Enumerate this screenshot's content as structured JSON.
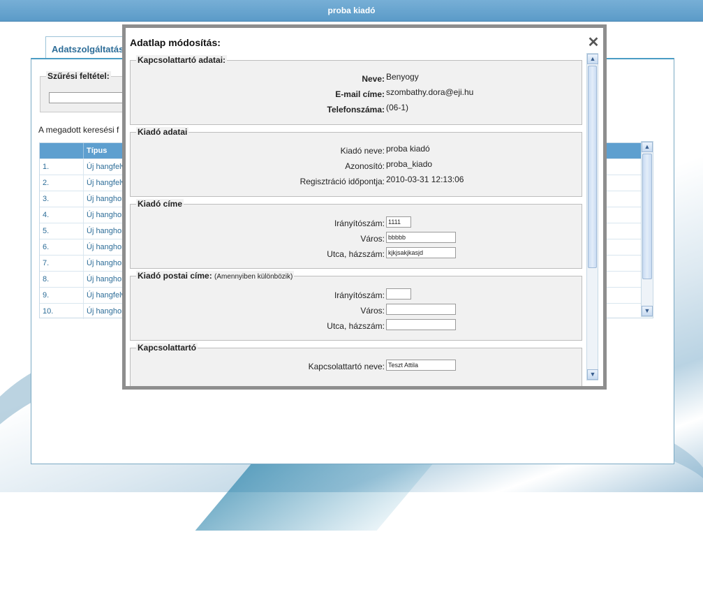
{
  "header": {
    "title": "proba kiadó"
  },
  "background": {
    "tab_label": "Adatszolgáltatás",
    "filter_label": "Szűrési feltétel:",
    "result_text": "A megadott keresési f",
    "grid": {
      "col_type": "Típus",
      "rows": [
        {
          "num": "1.",
          "type": "Új hangfelv"
        },
        {
          "num": "2.",
          "type": "Új hangfelv"
        },
        {
          "num": "3.",
          "type": "Új hanghor"
        },
        {
          "num": "4.",
          "type": "Új hanghor"
        },
        {
          "num": "5.",
          "type": "Új hanghor"
        },
        {
          "num": "6.",
          "type": "Új hanghor"
        },
        {
          "num": "7.",
          "type": "Új hanghor"
        },
        {
          "num": "8.",
          "type": "Új hanghor"
        },
        {
          "num": "9.",
          "type": "Új hangfelv"
        },
        {
          "num": "10.",
          "type": "Új hanghor"
        }
      ]
    }
  },
  "modal": {
    "title": "Adatlap módosítás:",
    "close_symbol": "✕",
    "sections": {
      "contact": {
        "legend": "Kapcsolattartó adatai:",
        "name_label": "Neve:",
        "name_value": "Benyogy",
        "email_label": "E-mail címe:",
        "email_value": "szombathy.dora@eji.hu",
        "phone_label": "Telefonszáma:",
        "phone_value": "(06-1)"
      },
      "publisher": {
        "legend": "Kiadó adatai",
        "name_label": "Kiadó neve:",
        "name_value": "proba kiadó",
        "id_label": "Azonosító:",
        "id_value": "proba_kiado",
        "reg_label": "Regisztráció időpontja:",
        "reg_value": "2010-03-31 12:13:06"
      },
      "address": {
        "legend": "Kiadó címe",
        "zip_label": "Irányítószám:",
        "zip_value": "1111",
        "city_label": "Város:",
        "city_value": "bbbbb",
        "street_label": "Utca, házszám:",
        "street_value": "kjkjsakjkasjd"
      },
      "postal": {
        "legend": "Kiadó postai címe:",
        "legend_note": "(Amennyiben különbözik)",
        "zip_label": "Irányítószám:",
        "zip_value": "",
        "city_label": "Város:",
        "city_value": "",
        "street_label": "Utca, házszám:",
        "street_value": ""
      },
      "contact_person": {
        "legend": "Kapcsolattartó",
        "name_label": "Kapcsolattartó neve:",
        "name_value": "Teszt Attila"
      }
    }
  },
  "icons": {
    "scroll_up": "up-arrow",
    "scroll_down": "down-arrow",
    "close": "close-icon"
  }
}
